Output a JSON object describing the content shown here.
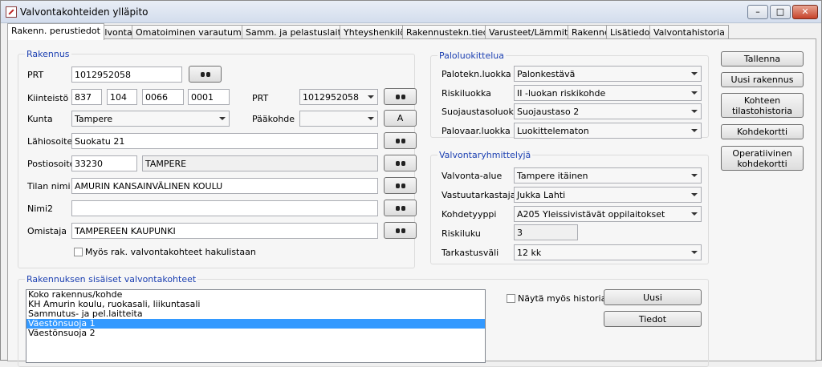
{
  "window": {
    "title": "Valvontakohteiden ylläpito",
    "min": "–",
    "max": "□",
    "close": "✕"
  },
  "tabs": [
    "Rakenn. perustiedot",
    "Valvonta",
    "Omatoiminen varautuminen",
    "Samm. ja pelastuslaitteet",
    "Yhteyshenkilöt",
    "Rakennustekn.tiedot",
    "Varusteet/Lämmitys",
    "Rakenne",
    "Lisätiedot",
    "Valvontahistoria"
  ],
  "rakennus": {
    "legend": "Rakennus",
    "prt_label": "PRT",
    "prt_value": "1012952058",
    "kiinteisto_label": "Kiinteistö",
    "k1": "837",
    "k2": "104",
    "k3": "0066",
    "k4": "0001",
    "prt2_label": "PRT",
    "prt2_value": "1012952058",
    "kunta_label": "Kunta",
    "kunta_value": "Tampere",
    "paakohde_label": "Pääkohde",
    "paakohde_value": "",
    "a_button": "A",
    "lahiosoite_label": "Lähiosoite",
    "lahiosoite_value": "Suokatu 21",
    "postiosoite_label": "Postiosoite",
    "postinumero": "33230",
    "postitoimipaikka": "TAMPERE",
    "tilan_nimi_label": "Tilan nimi",
    "tilan_nimi_value": "AMURIN KANSAINVÄLINEN KOULU",
    "nimi2_label": "Nimi2",
    "nimi2_value": "",
    "omistaja_label": "Omistaja",
    "omistaja_value": "TAMPEREEN KAUPUNKI",
    "hakulista_label": "Myös rak. valvontakohteet hakulistaan"
  },
  "paloluokittelu": {
    "legend": "Paloluokittelua",
    "rows": [
      {
        "label": "Palotekn.luokka",
        "value": "Palonkestävä"
      },
      {
        "label": "Riskiluokka",
        "value": "II -luokan riskikohde"
      },
      {
        "label": "Suojaustasoluokka",
        "value": "Suojaustaso 2"
      },
      {
        "label": "Palovaar.luokka",
        "value": "Luokittelematon"
      }
    ]
  },
  "valvontaryhmittely": {
    "legend": "Valvontaryhmittelyjä",
    "valvonta_alue_label": "Valvonta-alue",
    "valvonta_alue_value": "Tampere itäinen",
    "vastuutarkastaja_label": "Vastuutarkastaja",
    "vastuutarkastaja_value": "Jukka Lahti",
    "kohdetyyppi_label": "Kohdetyyppi",
    "kohdetyyppi_value": "A205 Yleissivistävät oppilaitokset",
    "riskiluku_label": "Riskiluku",
    "riskiluku_value": "3",
    "tarkastusvali_label": "Tarkastusväli",
    "tarkastusvali_value": "12 kk"
  },
  "side_buttons": {
    "tallenna": "Tallenna",
    "uusi_rakennus": "Uusi rakennus",
    "tilastohistoria_1": "Kohteen",
    "tilastohistoria_2": "tilastohistoria",
    "kohdekortti": "Kohdekortti",
    "operatiivinen_1": "Operatiivinen",
    "operatiivinen_2": "kohdekortti"
  },
  "sisaiset": {
    "legend": "Rakennuksen sisäiset valvontakohteet",
    "items": [
      "Koko rakennus/kohde",
      "KH Amurin koulu, ruokasali, liikuntasali",
      "Sammutus- ja pel.laitteita",
      "Väestönsuoja 1",
      "Väestönsuoja 2"
    ],
    "selected_index": 3,
    "historia_label": "Näytä myös historia",
    "uusi": "Uusi",
    "tiedot": "Tiedot"
  }
}
